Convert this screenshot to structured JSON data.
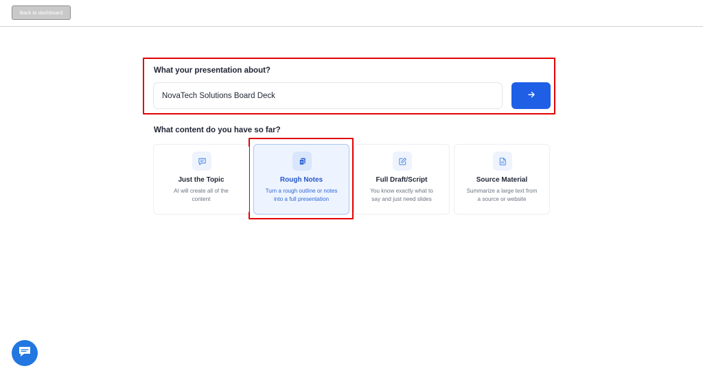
{
  "header": {
    "back_label": "Back to dashboard"
  },
  "topic": {
    "question": "What your presentation about?",
    "value": "NovaTech Solutions Board Deck",
    "submit_icon": "arrow-right-icon"
  },
  "content": {
    "question": "What content do you have so far?",
    "selected": "Rough Notes",
    "options": [
      {
        "icon": "message-icon",
        "title": "Just the Topic",
        "desc_line1": "AI will create all of the",
        "desc_line2": "content"
      },
      {
        "icon": "copy-icon",
        "title": "Rough Notes",
        "desc_line1": "Turn a rough outline or notes",
        "desc_line2": "into a full presentation"
      },
      {
        "icon": "edit-icon",
        "title": "Full Draft/Script",
        "desc_line1": "You know exactly what to",
        "desc_line2": "say and just need slides"
      },
      {
        "icon": "document-icon",
        "title": "Source Material",
        "desc_line1": "Summarize a large text from",
        "desc_line2": "a source or website"
      }
    ]
  },
  "colors": {
    "primary": "#1e5fe6",
    "highlight": "#e00000",
    "selected_bg": "#eef4ff"
  },
  "chat": {
    "icon": "chat-icon"
  }
}
